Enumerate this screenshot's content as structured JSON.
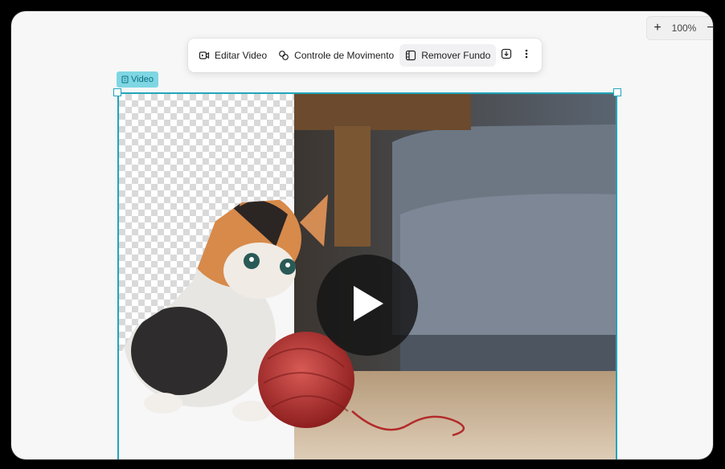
{
  "zoom": {
    "plus": "+",
    "value": "100%",
    "minus": "−"
  },
  "toolbar": {
    "edit_video": "Editar Video",
    "motion_control": "Controle de Movimento",
    "remove_background": "Remover Fundo"
  },
  "tag": {
    "label": "Video"
  },
  "icons": {
    "edit": "edit-video-icon",
    "motion": "motion-control-icon",
    "remove_bg": "remove-background-icon",
    "download": "download-icon",
    "more": "more-vertical-icon",
    "play": "play-icon"
  },
  "colors": {
    "accent": "#21a5ba",
    "tag_bg": "#7fd6e3"
  }
}
